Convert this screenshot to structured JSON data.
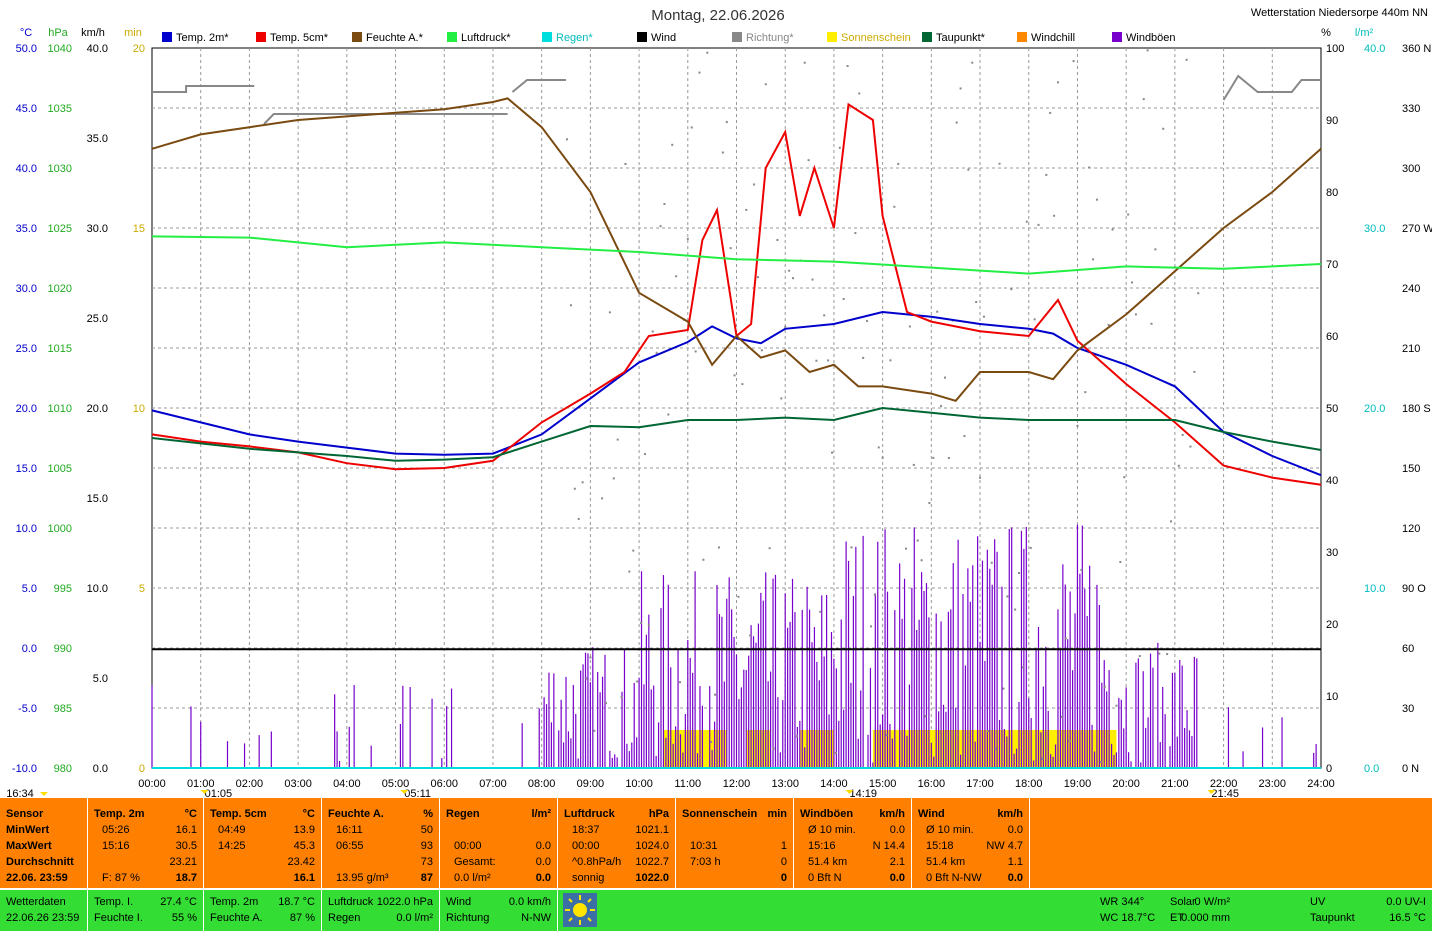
{
  "title": "Montag, 22.06.2026",
  "station": "Wetterstation Niedersorpe 440m NN",
  "legend": [
    {
      "name": "Temp. 2m*",
      "color": "#0000cc"
    },
    {
      "name": "Temp. 5cm*",
      "color": "#ee0000"
    },
    {
      "name": "Feuchte A.*",
      "color": "#7a4a10"
    },
    {
      "name": "Luftdruck*",
      "color": "#22ee44"
    },
    {
      "name": "Regen*",
      "color": "#00dddd"
    },
    {
      "name": "Wind",
      "color": "#000000"
    },
    {
      "name": "Richtung*",
      "color": "#888888"
    },
    {
      "name": "Sonnenschein",
      "color": "#ffee00"
    },
    {
      "name": "Taupunkt*",
      "color": "#006633"
    },
    {
      "name": "Windchill",
      "color": "#ff8800"
    },
    {
      "name": "Windböen",
      "color": "#7700cc"
    }
  ],
  "units": {
    "temp": "°C",
    "press": "hPa",
    "wind": "km/h",
    "sun": "min",
    "hum": "%",
    "rain": "l/m²"
  },
  "chart_data": {
    "type": "line",
    "x_ticks": [
      "00:00",
      "01:00",
      "02:00",
      "03:00",
      "04:00",
      "05:00",
      "06:00",
      "07:00",
      "08:00",
      "09:00",
      "10:00",
      "11:00",
      "12:00",
      "13:00",
      "14:00",
      "15:00",
      "16:00",
      "17:00",
      "18:00",
      "19:00",
      "20:00",
      "21:00",
      "22:00",
      "23:00",
      "24:00"
    ],
    "axes": {
      "temp": {
        "min": -10,
        "max": 50,
        "ticks": [
          "50.0",
          "45.0",
          "40.0",
          "35.0",
          "30.0",
          "25.0",
          "20.0",
          "15.0",
          "10.0",
          "5.0",
          "0.0",
          "-5.0",
          "-10.0"
        ]
      },
      "press": {
        "min": 980,
        "max": 1040,
        "ticks": [
          "1040",
          "1035",
          "1030",
          "1025",
          "1020",
          "1015",
          "1010",
          "1005",
          "1000",
          "995",
          "990",
          "985",
          "980"
        ]
      },
      "wind": {
        "min": 0,
        "max": 40,
        "ticks": [
          "40.0",
          "35.0",
          "30.0",
          "25.0",
          "20.0",
          "15.0",
          "10.0",
          "5.0",
          "0.0"
        ]
      },
      "sun": {
        "min": 0,
        "max": 20,
        "ticks": [
          "20",
          "15",
          "10",
          "5",
          "0"
        ]
      },
      "hum": {
        "min": 0,
        "max": 100,
        "ticks": [
          "100",
          "90",
          "80",
          "70",
          "60",
          "50",
          "40",
          "30",
          "20",
          "10",
          "0"
        ]
      },
      "rain": {
        "min": 0,
        "max": 40,
        "ticks": [
          "40.0",
          "30.0",
          "20.0",
          "10.0",
          "0.0"
        ]
      },
      "dir": {
        "min": 0,
        "max": 360,
        "ticks": [
          "360 N",
          "330",
          "300",
          "270 W",
          "240",
          "210",
          "180 S",
          "150",
          "120",
          "90 O",
          "60",
          "30",
          "0 N"
        ]
      }
    },
    "series": [
      {
        "name": "Temp. 2m*",
        "axis": "temp",
        "color": "#0000cc",
        "points": [
          [
            0,
            19.8
          ],
          [
            1,
            18.8
          ],
          [
            2,
            17.8
          ],
          [
            3,
            17.2
          ],
          [
            4,
            16.7
          ],
          [
            5,
            16.2
          ],
          [
            6,
            16.1
          ],
          [
            7,
            16.2
          ],
          [
            8,
            17.8
          ],
          [
            9,
            20.8
          ],
          [
            10,
            23.8
          ],
          [
            11,
            25.5
          ],
          [
            11.5,
            26.8
          ],
          [
            12,
            25.8
          ],
          [
            12.5,
            25.4
          ],
          [
            13,
            26.6
          ],
          [
            14,
            27.0
          ],
          [
            14.5,
            27.5
          ],
          [
            15,
            28.0
          ],
          [
            16,
            27.6
          ],
          [
            17,
            27.0
          ],
          [
            18,
            26.6
          ],
          [
            18.5,
            26.2
          ],
          [
            19,
            25.0
          ],
          [
            20,
            23.6
          ],
          [
            21,
            21.8
          ],
          [
            22,
            18.0
          ],
          [
            23,
            16.0
          ],
          [
            24,
            14.4
          ]
        ]
      },
      {
        "name": "Temp. 5cm*",
        "axis": "temp",
        "color": "#ee0000",
        "points": [
          [
            0,
            17.8
          ],
          [
            1,
            17.2
          ],
          [
            2,
            16.8
          ],
          [
            3,
            16.3
          ],
          [
            4,
            15.4
          ],
          [
            5,
            14.9
          ],
          [
            6,
            15.0
          ],
          [
            7,
            15.6
          ],
          [
            8,
            18.8
          ],
          [
            9,
            21.2
          ],
          [
            9.7,
            23.0
          ],
          [
            10.2,
            26.0
          ],
          [
            11,
            26.5
          ],
          [
            11.3,
            34.0
          ],
          [
            11.6,
            36.5
          ],
          [
            12,
            26.0
          ],
          [
            12.3,
            27.0
          ],
          [
            12.6,
            40.0
          ],
          [
            13,
            43.0
          ],
          [
            13.3,
            36.0
          ],
          [
            13.6,
            40.0
          ],
          [
            14,
            35.0
          ],
          [
            14.3,
            45.3
          ],
          [
            14.8,
            44.0
          ],
          [
            15,
            36.0
          ],
          [
            15.5,
            28.0
          ],
          [
            16,
            27.2
          ],
          [
            17,
            26.4
          ],
          [
            18,
            26.0
          ],
          [
            18.6,
            29.0
          ],
          [
            19,
            25.6
          ],
          [
            20,
            22.0
          ],
          [
            21,
            18.8
          ],
          [
            22,
            15.2
          ],
          [
            23,
            14.2
          ],
          [
            24,
            13.6
          ]
        ]
      },
      {
        "name": "Feuchte A.*",
        "axis": "hum",
        "color": "#7a4a10",
        "points": [
          [
            0,
            86
          ],
          [
            0.5,
            87
          ],
          [
            1,
            88
          ],
          [
            2,
            89
          ],
          [
            3,
            90
          ],
          [
            4,
            90.5
          ],
          [
            5,
            91
          ],
          [
            6,
            91.5
          ],
          [
            7,
            92.5
          ],
          [
            7.3,
            93
          ],
          [
            8,
            89
          ],
          [
            9,
            80
          ],
          [
            10,
            66
          ],
          [
            11,
            62
          ],
          [
            11.5,
            56
          ],
          [
            12,
            60
          ],
          [
            12.5,
            57
          ],
          [
            13,
            58
          ],
          [
            13.5,
            55
          ],
          [
            14,
            56
          ],
          [
            14.5,
            53
          ],
          [
            15,
            53
          ],
          [
            16,
            52
          ],
          [
            16.5,
            51
          ],
          [
            17,
            55
          ],
          [
            18,
            55
          ],
          [
            18.5,
            54
          ],
          [
            19,
            58
          ],
          [
            20,
            63
          ],
          [
            21,
            69
          ],
          [
            22,
            75
          ],
          [
            23,
            80
          ],
          [
            24,
            86
          ]
        ]
      },
      {
        "name": "Luftdruck*",
        "axis": "press",
        "color": "#22ee44",
        "points": [
          [
            0,
            1024.3
          ],
          [
            2,
            1024.2
          ],
          [
            4,
            1023.4
          ],
          [
            6,
            1023.8
          ],
          [
            8,
            1023.4
          ],
          [
            10,
            1023.0
          ],
          [
            12,
            1022.4
          ],
          [
            14,
            1022.2
          ],
          [
            16,
            1021.7
          ],
          [
            18,
            1021.2
          ],
          [
            20,
            1021.8
          ],
          [
            22,
            1021.6
          ],
          [
            24,
            1022.0
          ]
        ]
      },
      {
        "name": "Taupunkt*",
        "axis": "temp",
        "color": "#006633",
        "points": [
          [
            0,
            17.5
          ],
          [
            2,
            16.6
          ],
          [
            4,
            16.0
          ],
          [
            5,
            15.6
          ],
          [
            6,
            15.7
          ],
          [
            7,
            15.9
          ],
          [
            8,
            17.2
          ],
          [
            9,
            18.5
          ],
          [
            10,
            18.4
          ],
          [
            11,
            19.0
          ],
          [
            12,
            19.0
          ],
          [
            13,
            19.2
          ],
          [
            14,
            19.0
          ],
          [
            15,
            20.0
          ],
          [
            16,
            19.6
          ],
          [
            17,
            19.2
          ],
          [
            18,
            19.0
          ],
          [
            19,
            19.0
          ],
          [
            20,
            19.0
          ],
          [
            21,
            19.0
          ],
          [
            22,
            18.0
          ],
          [
            23,
            17.2
          ],
          [
            24,
            16.5
          ]
        ]
      },
      {
        "name": "Wind",
        "axis": "wind",
        "color": "#000000",
        "points": [
          [
            0,
            6.6
          ],
          [
            24,
            6.6
          ]
        ]
      },
      {
        "name": "Regen*",
        "axis": "rain",
        "color": "#00dddd",
        "points": [
          [
            0,
            0
          ],
          [
            24,
            0
          ]
        ]
      }
    ],
    "sunshine": {
      "axis": "sun",
      "color": "#ffee00",
      "blocks": [
        [
          10.5,
          11.8,
          1
        ],
        [
          12.2,
          12.7,
          1
        ],
        [
          13.3,
          14.0,
          1
        ],
        [
          14.8,
          19.8,
          1
        ]
      ]
    },
    "gusts": {
      "axis": "wind",
      "color": "#7700cc"
    },
    "time_markers": [
      {
        "label": "16:34",
        "x": 0
      },
      {
        "label": "01:05",
        "x": 1.08
      },
      {
        "label": "05:11",
        "x": 5.18
      },
      {
        "label": "14:19",
        "x": 14.32
      },
      {
        "label": "21:45",
        "x": 21.75
      }
    ]
  },
  "table": {
    "cols": [
      {
        "head": [
          "Sensor",
          ""
        ],
        "rows": [
          [
            "MinWert",
            ""
          ],
          [
            "MaxWert",
            ""
          ],
          [
            "Durchschnitt",
            ""
          ],
          [
            "22.06. 23:59",
            ""
          ]
        ]
      },
      {
        "head": [
          "Temp. 2m",
          "°C"
        ],
        "rows": [
          [
            "05:26",
            "16.1"
          ],
          [
            "15:16",
            "30.5"
          ],
          [
            "",
            "23.21"
          ],
          [
            "F: 87 %",
            "18.7"
          ]
        ]
      },
      {
        "head": [
          "Temp. 5cm",
          "°C"
        ],
        "rows": [
          [
            "04:49",
            "13.9"
          ],
          [
            "14:25",
            "45.3"
          ],
          [
            "",
            "23.42"
          ],
          [
            "",
            "16.1"
          ]
        ]
      },
      {
        "head": [
          "Feuchte A.",
          "%"
        ],
        "rows": [
          [
            "16:11",
            "50"
          ],
          [
            "06:55",
            "93"
          ],
          [
            "",
            "73"
          ],
          [
            "13.95 g/m³",
            "87"
          ]
        ]
      },
      {
        "head": [
          "Regen",
          "l/m²"
        ],
        "rows": [
          [
            "",
            ""
          ],
          [
            "00:00",
            "0.0"
          ],
          [
            "Gesamt:",
            "0.0"
          ],
          [
            "0.0 l/m²",
            "0.0"
          ]
        ]
      },
      {
        "head": [
          "Luftdruck",
          "hPa"
        ],
        "rows": [
          [
            "18:37",
            "1021.1"
          ],
          [
            "00:00",
            "1024.0"
          ],
          [
            "^0.8hPa/h",
            "1022.7"
          ],
          [
            "sonnig",
            "1022.0"
          ]
        ]
      },
      {
        "head": [
          "Sonnenschein",
          "min"
        ],
        "rows": [
          [
            "",
            ""
          ],
          [
            "10:31",
            "1"
          ],
          [
            "7:03 h",
            "0"
          ],
          [
            "",
            "0"
          ]
        ]
      },
      {
        "head": [
          "Windböen",
          "km/h"
        ],
        "rows": [
          [
            "Ø 10 min.",
            "0.0"
          ],
          [
            "15:16",
            "N 14.4"
          ],
          [
            "51.4 km",
            "2.1"
          ],
          [
            "0 Bft N",
            "0.0"
          ]
        ]
      },
      {
        "head": [
          "Wind",
          "km/h"
        ],
        "rows": [
          [
            "Ø 10 min.",
            "0.0"
          ],
          [
            "15:18",
            "NW 4.7"
          ],
          [
            "51.4 km",
            "1.1"
          ],
          [
            "0 Bft N-NW",
            "0.0"
          ]
        ]
      }
    ]
  },
  "status": {
    "label1": "Wetterdaten",
    "label2": "22.06.26 23:59",
    "ti_label": "Temp. I.",
    "ti": "27.4 °C",
    "fi_label": "Feuchte I.",
    "fi": "55 %",
    "t2_label": "Temp. 2m",
    "t2": "18.7 °C",
    "fa_label": "Feuchte A.",
    "fa": "87 %",
    "lp_label": "Luftdruck",
    "lp": "1022.0 hPa",
    "rg_label": "Regen",
    "rg": "0.0 l/m²",
    "wind_label": "Wind",
    "wind": "0.0 km/h",
    "rich_label": "Richtung",
    "rich": "N-NW",
    "wr": "WR 344°",
    "wc": "WC 18.7°C",
    "solar_label": "Solar",
    "solar": "0 W/m²",
    "et_label": "ET",
    "et": "0.000 mm",
    "uv_label": "UV",
    "uv": "0.0 UV-I",
    "tp_label": "Taupunkt",
    "tp": "16.5 °C"
  }
}
